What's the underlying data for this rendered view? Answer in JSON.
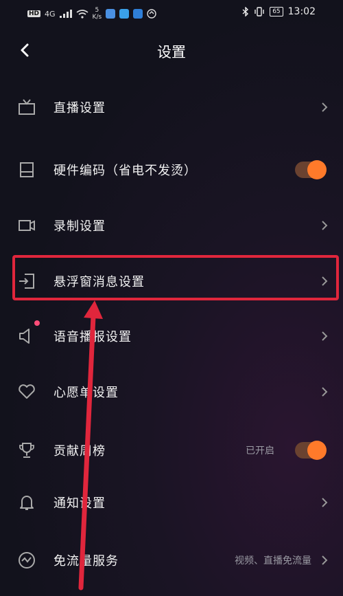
{
  "status_bar": {
    "hd_badge": "HD",
    "network": "4G",
    "speed_value": "5",
    "speed_unit": "K/s",
    "battery": "65",
    "time": "13:02"
  },
  "header": {
    "title": "设置"
  },
  "settings": {
    "live": {
      "label": "直播设置"
    },
    "hw_encoding": {
      "label": "硬件编码（省电不发烫）",
      "enabled": true
    },
    "recording": {
      "label": "录制设置"
    },
    "floating_window": {
      "label": "悬浮窗消息设置"
    },
    "voice_broadcast": {
      "label": "语音播报设置",
      "has_badge": true
    },
    "wishlist": {
      "label": "心愿单设置"
    },
    "contribution": {
      "label": "贡献周榜",
      "status": "已开启",
      "enabled": true
    },
    "notification": {
      "label": "通知设置"
    },
    "free_data": {
      "label": "免流量服务",
      "value": "视频、直播免流量"
    }
  },
  "colors": {
    "accent_toggle": "#ff7a2a",
    "highlight_box": "#e0263c",
    "badge_dot": "#ff4d79"
  }
}
